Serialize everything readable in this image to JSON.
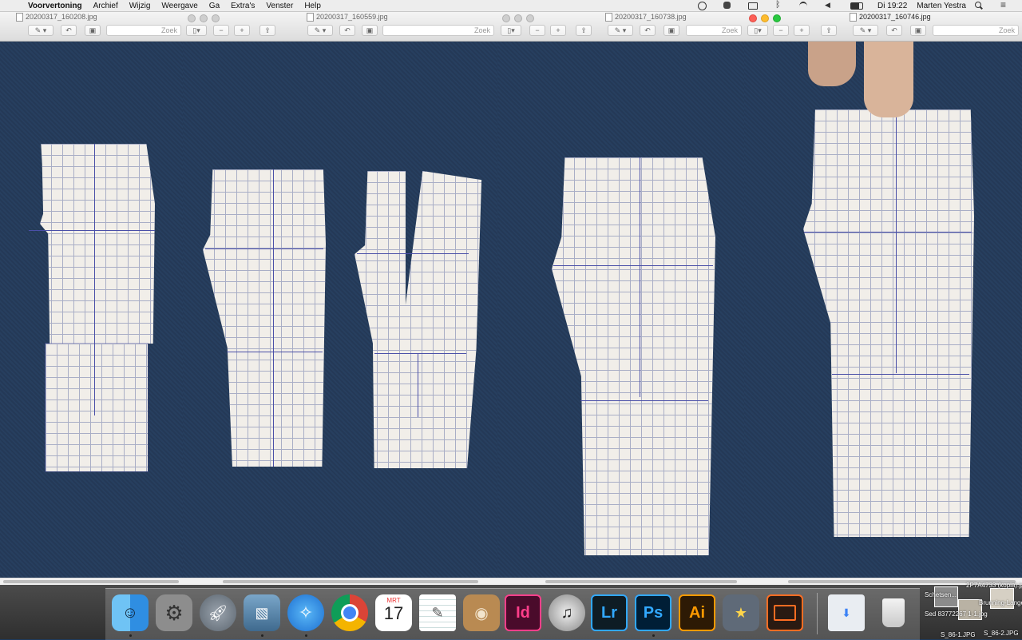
{
  "menubar": {
    "app": "Voorvertoning",
    "items": [
      "Archief",
      "Wijzig",
      "Weergave",
      "Ga",
      "Extra's",
      "Venster",
      "Help"
    ],
    "clock": "Di 19:22",
    "user": "Marten Yestra"
  },
  "windows": [
    {
      "title": "20200317_160208.jpg",
      "search_placeholder": "Zoek"
    },
    {
      "title": "20200317_160559.jpg",
      "search_placeholder": "Zoek"
    },
    {
      "title": "20200317_160738.jpg",
      "search_placeholder": "Zoek"
    },
    {
      "title": "20200317_160746.jpg",
      "search_placeholder": "Zoek"
    }
  ],
  "dock": {
    "calendar_month": "MRT",
    "calendar_day": "17",
    "indesign_label": "Id",
    "lightroom_label": "Lr",
    "photoshop_label": "Ps",
    "illustrator_label": "Ai",
    "files": [
      "2P7A4733 (kopia).jpg",
      "Schetsen...",
      "Sed 83772267 1-1.jpg",
      "Brunning-Langen...-2s.jpg",
      "S_86-1.JPG",
      "S_86-2.JPG"
    ]
  },
  "colors": {
    "active_close": "#fc5f57",
    "active_minimize": "#fdbc2e",
    "active_zoom": "#28c840",
    "fabric": "#243957"
  }
}
